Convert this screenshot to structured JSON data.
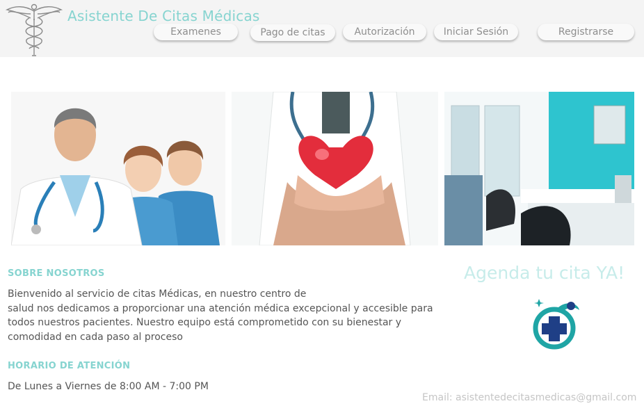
{
  "header": {
    "site_title": "Asistente De Citas Médicas",
    "logo_icon": "caduceus-icon"
  },
  "nav": [
    {
      "label": "Examenes"
    },
    {
      "label": "Pago de citas"
    },
    {
      "label": "Autorización"
    },
    {
      "label": "Iniciar Sesión"
    },
    {
      "label": "Registrarse"
    }
  ],
  "gallery": [
    {
      "icon": "doctors-team-photo"
    },
    {
      "icon": "heart-in-hands-photo"
    },
    {
      "icon": "clinic-room-photo"
    }
  ],
  "about": {
    "title": "SOBRE NOSOTROS",
    "lines": [
      "Bienvenido al servicio de citas Médicas, en nuestro centro de",
      "salud nos dedicamos a proporcionar una atención médica excepcional y accesible para",
      "todos nuestros pacientes. Nuestro equipo está comprometido con su bienestar y",
      "comodidad en cada paso al proceso"
    ]
  },
  "hours": {
    "title": "HORARIO DE ATENCIÓN",
    "text": "De Lunes a Viernes de 8:00 AM - 7:00 PM"
  },
  "cta": {
    "text": "Agenda tu cita YA!",
    "icon": "medical-cross-icon"
  },
  "footer": {
    "email": "Email: asistentedecitasmedicas@gmail.com"
  },
  "colors": {
    "accent": "#86d4d0",
    "cta_text": "#c7ecea",
    "header_bg": "#f4f4f4",
    "cross_blue": "#1f3f86",
    "cross_teal": "#1fa5a5"
  }
}
